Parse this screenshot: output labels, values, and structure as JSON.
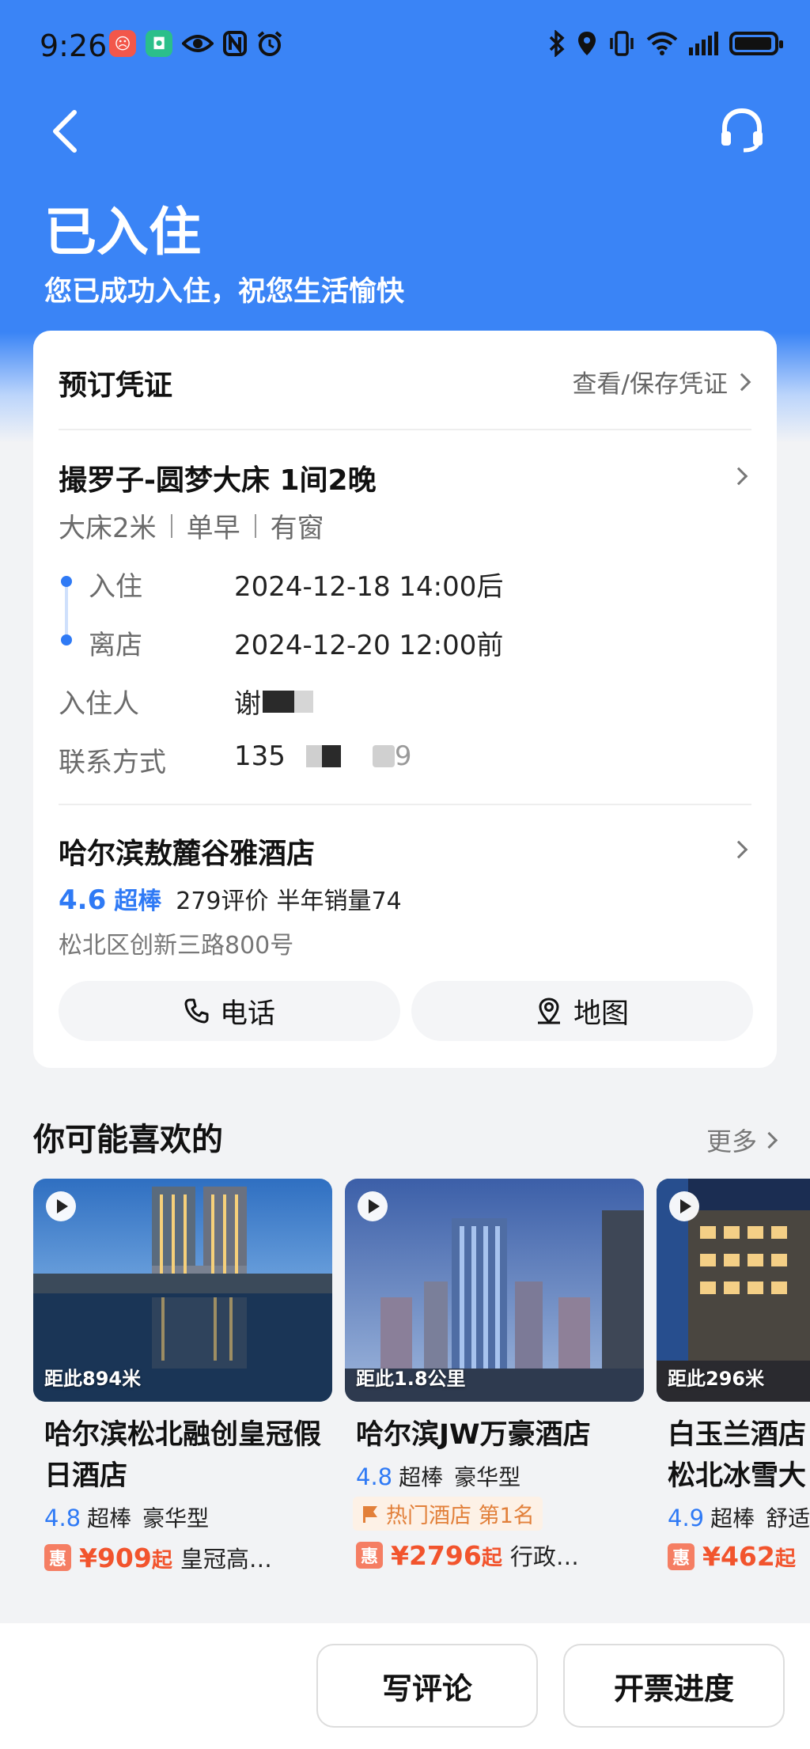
{
  "status_bar": {
    "time": "9:26",
    "badge_icons": [
      "app-badge-red-icon",
      "app-badge-green-icon"
    ],
    "icons": [
      "eye-icon",
      "nfc-icon",
      "alarm-icon",
      "bluetooth-icon",
      "location-icon",
      "vibrate-icon",
      "wifi-icon",
      "signal-icon",
      "battery-icon"
    ]
  },
  "header": {
    "title": "已入住",
    "subtitle": "您已成功入住，祝您生活愉快"
  },
  "booking": {
    "section_title": "预订凭证",
    "voucher_link": "查看/保存凭证",
    "room_title": "撮罗子-圆梦大床 1间2晚",
    "tags": [
      "大床2米",
      "单早",
      "有窗"
    ],
    "checkin_label": "入住",
    "checkin_value": "2024-12-18 14:00后",
    "checkout_label": "离店",
    "checkout_value": "2024-12-20 12:00前",
    "guest_label": "入住人",
    "guest_value": "谢",
    "contact_label": "联系方式",
    "contact_value": "135",
    "contact_tail": "9"
  },
  "hotel": {
    "name": "哈尔滨敖麓谷雅酒店",
    "rating": "4.6",
    "rating_word": "超棒",
    "reviews": "279评价",
    "sales": "半年销量74",
    "address": "松北区创新三路800号",
    "phone_label": "电话",
    "map_label": "地图"
  },
  "recommendations": {
    "title": "你可能喜欢的",
    "more_label": "更多",
    "items": [
      {
        "distance": "距此894米",
        "name": "哈尔滨松北融创皇冠假日酒店",
        "rating": "4.8",
        "rating_word": "超棒",
        "type": "豪华型",
        "badge": "惠",
        "price": "¥909",
        "price_suffix": "起",
        "perk": "皇冠高…"
      },
      {
        "distance": "距此1.8公里",
        "name": "哈尔滨JW万豪酒店",
        "rating": "4.8",
        "rating_word": "超棒",
        "type": "豪华型",
        "hot_rank": "热门酒店 第1名",
        "badge": "惠",
        "price": "¥2796",
        "price_suffix": "起",
        "perk": "行政…"
      },
      {
        "distance": "距此296米",
        "name": "白玉兰酒店松北冰雪大",
        "rating": "4.9",
        "rating_word": "超棒",
        "type": "舒适",
        "badge": "惠",
        "price": "¥462",
        "price_suffix": "起",
        "perk": ""
      }
    ]
  },
  "footer": {
    "review_button": "写评论",
    "invoice_button": "开票进度"
  },
  "colors": {
    "brand_blue": "#3a84f6",
    "accent_blue": "#2f7af5",
    "price_red": "#f2542d",
    "hot_orange": "#e2803a"
  }
}
